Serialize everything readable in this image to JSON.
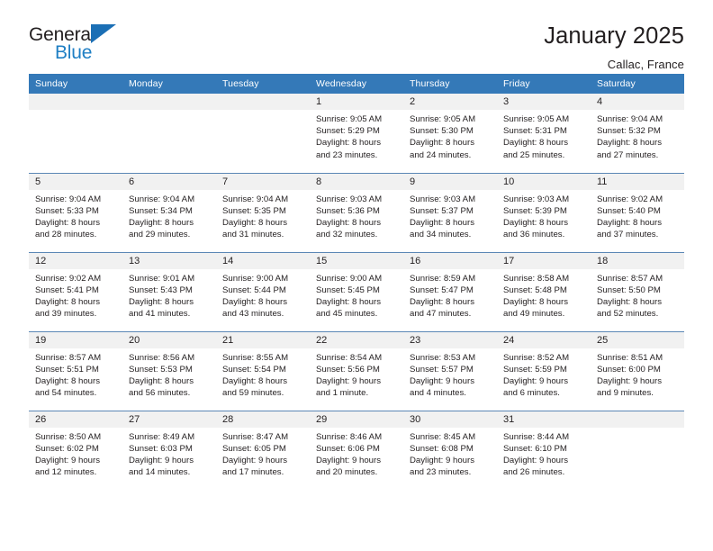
{
  "logo": {
    "word_one": "General",
    "word_two": "Blue",
    "mark": "triangle-mark"
  },
  "header": {
    "title": "January 2025",
    "location": "Callac, France"
  },
  "calendar": {
    "weekday_headers": [
      "Sunday",
      "Monday",
      "Tuesday",
      "Wednesday",
      "Thursday",
      "Friday",
      "Saturday"
    ],
    "accent_color": "#3479b8",
    "daynum_band_color": "#f1f1f1",
    "weeks": [
      [
        {
          "day": "",
          "lines": []
        },
        {
          "day": "",
          "lines": []
        },
        {
          "day": "",
          "lines": []
        },
        {
          "day": "1",
          "lines": [
            "Sunrise: 9:05 AM",
            "Sunset: 5:29 PM",
            "Daylight: 8 hours",
            "and 23 minutes."
          ]
        },
        {
          "day": "2",
          "lines": [
            "Sunrise: 9:05 AM",
            "Sunset: 5:30 PM",
            "Daylight: 8 hours",
            "and 24 minutes."
          ]
        },
        {
          "day": "3",
          "lines": [
            "Sunrise: 9:05 AM",
            "Sunset: 5:31 PM",
            "Daylight: 8 hours",
            "and 25 minutes."
          ]
        },
        {
          "day": "4",
          "lines": [
            "Sunrise: 9:04 AM",
            "Sunset: 5:32 PM",
            "Daylight: 8 hours",
            "and 27 minutes."
          ]
        }
      ],
      [
        {
          "day": "5",
          "lines": [
            "Sunrise: 9:04 AM",
            "Sunset: 5:33 PM",
            "Daylight: 8 hours",
            "and 28 minutes."
          ]
        },
        {
          "day": "6",
          "lines": [
            "Sunrise: 9:04 AM",
            "Sunset: 5:34 PM",
            "Daylight: 8 hours",
            "and 29 minutes."
          ]
        },
        {
          "day": "7",
          "lines": [
            "Sunrise: 9:04 AM",
            "Sunset: 5:35 PM",
            "Daylight: 8 hours",
            "and 31 minutes."
          ]
        },
        {
          "day": "8",
          "lines": [
            "Sunrise: 9:03 AM",
            "Sunset: 5:36 PM",
            "Daylight: 8 hours",
            "and 32 minutes."
          ]
        },
        {
          "day": "9",
          "lines": [
            "Sunrise: 9:03 AM",
            "Sunset: 5:37 PM",
            "Daylight: 8 hours",
            "and 34 minutes."
          ]
        },
        {
          "day": "10",
          "lines": [
            "Sunrise: 9:03 AM",
            "Sunset: 5:39 PM",
            "Daylight: 8 hours",
            "and 36 minutes."
          ]
        },
        {
          "day": "11",
          "lines": [
            "Sunrise: 9:02 AM",
            "Sunset: 5:40 PM",
            "Daylight: 8 hours",
            "and 37 minutes."
          ]
        }
      ],
      [
        {
          "day": "12",
          "lines": [
            "Sunrise: 9:02 AM",
            "Sunset: 5:41 PM",
            "Daylight: 8 hours",
            "and 39 minutes."
          ]
        },
        {
          "day": "13",
          "lines": [
            "Sunrise: 9:01 AM",
            "Sunset: 5:43 PM",
            "Daylight: 8 hours",
            "and 41 minutes."
          ]
        },
        {
          "day": "14",
          "lines": [
            "Sunrise: 9:00 AM",
            "Sunset: 5:44 PM",
            "Daylight: 8 hours",
            "and 43 minutes."
          ]
        },
        {
          "day": "15",
          "lines": [
            "Sunrise: 9:00 AM",
            "Sunset: 5:45 PM",
            "Daylight: 8 hours",
            "and 45 minutes."
          ]
        },
        {
          "day": "16",
          "lines": [
            "Sunrise: 8:59 AM",
            "Sunset: 5:47 PM",
            "Daylight: 8 hours",
            "and 47 minutes."
          ]
        },
        {
          "day": "17",
          "lines": [
            "Sunrise: 8:58 AM",
            "Sunset: 5:48 PM",
            "Daylight: 8 hours",
            "and 49 minutes."
          ]
        },
        {
          "day": "18",
          "lines": [
            "Sunrise: 8:57 AM",
            "Sunset: 5:50 PM",
            "Daylight: 8 hours",
            "and 52 minutes."
          ]
        }
      ],
      [
        {
          "day": "19",
          "lines": [
            "Sunrise: 8:57 AM",
            "Sunset: 5:51 PM",
            "Daylight: 8 hours",
            "and 54 minutes."
          ]
        },
        {
          "day": "20",
          "lines": [
            "Sunrise: 8:56 AM",
            "Sunset: 5:53 PM",
            "Daylight: 8 hours",
            "and 56 minutes."
          ]
        },
        {
          "day": "21",
          "lines": [
            "Sunrise: 8:55 AM",
            "Sunset: 5:54 PM",
            "Daylight: 8 hours",
            "and 59 minutes."
          ]
        },
        {
          "day": "22",
          "lines": [
            "Sunrise: 8:54 AM",
            "Sunset: 5:56 PM",
            "Daylight: 9 hours",
            "and 1 minute."
          ]
        },
        {
          "day": "23",
          "lines": [
            "Sunrise: 8:53 AM",
            "Sunset: 5:57 PM",
            "Daylight: 9 hours",
            "and 4 minutes."
          ]
        },
        {
          "day": "24",
          "lines": [
            "Sunrise: 8:52 AM",
            "Sunset: 5:59 PM",
            "Daylight: 9 hours",
            "and 6 minutes."
          ]
        },
        {
          "day": "25",
          "lines": [
            "Sunrise: 8:51 AM",
            "Sunset: 6:00 PM",
            "Daylight: 9 hours",
            "and 9 minutes."
          ]
        }
      ],
      [
        {
          "day": "26",
          "lines": [
            "Sunrise: 8:50 AM",
            "Sunset: 6:02 PM",
            "Daylight: 9 hours",
            "and 12 minutes."
          ]
        },
        {
          "day": "27",
          "lines": [
            "Sunrise: 8:49 AM",
            "Sunset: 6:03 PM",
            "Daylight: 9 hours",
            "and 14 minutes."
          ]
        },
        {
          "day": "28",
          "lines": [
            "Sunrise: 8:47 AM",
            "Sunset: 6:05 PM",
            "Daylight: 9 hours",
            "and 17 minutes."
          ]
        },
        {
          "day": "29",
          "lines": [
            "Sunrise: 8:46 AM",
            "Sunset: 6:06 PM",
            "Daylight: 9 hours",
            "and 20 minutes."
          ]
        },
        {
          "day": "30",
          "lines": [
            "Sunrise: 8:45 AM",
            "Sunset: 6:08 PM",
            "Daylight: 9 hours",
            "and 23 minutes."
          ]
        },
        {
          "day": "31",
          "lines": [
            "Sunrise: 8:44 AM",
            "Sunset: 6:10 PM",
            "Daylight: 9 hours",
            "and 26 minutes."
          ]
        },
        {
          "day": "",
          "lines": []
        }
      ]
    ]
  }
}
